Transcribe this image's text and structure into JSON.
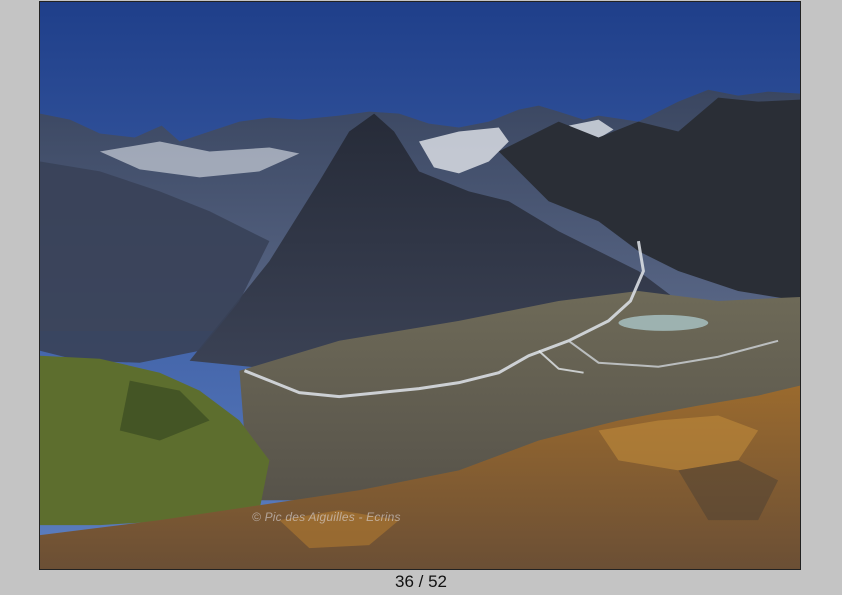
{
  "photo": {
    "watermark": "© Pic des Aiguilles - Ecrins",
    "subject": "alpine-valley-landscape"
  },
  "pager": {
    "current": 36,
    "total": 52,
    "label": "36 / 52"
  },
  "colors": {
    "background": "#c4c4c4",
    "sky_top": "#1f3f8a",
    "sky_bottom": "#5d7fc0"
  }
}
